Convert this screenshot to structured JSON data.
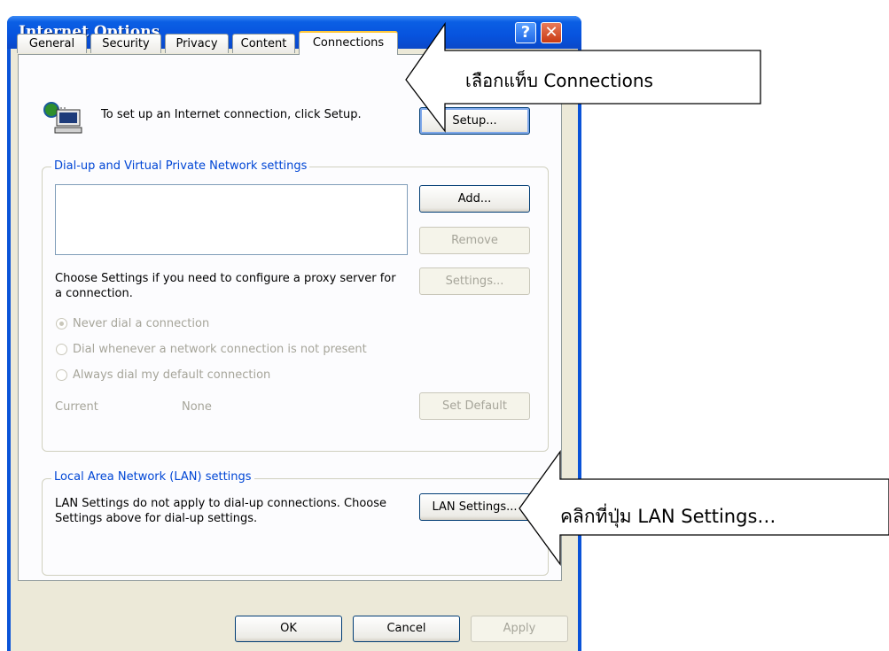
{
  "window": {
    "title": "Internet Options",
    "help_glyph": "?",
    "close_glyph": "✕"
  },
  "tabs": [
    {
      "label": "General"
    },
    {
      "label": "Security"
    },
    {
      "label": "Privacy"
    },
    {
      "label": "Content"
    },
    {
      "label": "Connections"
    }
  ],
  "setup": {
    "text": "To set up an Internet connection, click Setup.",
    "button": "Setup..."
  },
  "dialup": {
    "legend": "Dial-up and Virtual Private Network settings",
    "add": "Add...",
    "remove": "Remove",
    "settings_text": "Choose Settings if you need to configure a proxy server for a connection.",
    "settings": "Settings...",
    "radios": [
      "Never dial a connection",
      "Dial whenever a network connection is not present",
      "Always dial my default connection"
    ],
    "current_label": "Current",
    "current_value": "None",
    "set_default": "Set Default"
  },
  "lan": {
    "legend": "Local Area Network (LAN) settings",
    "text": "LAN Settings do not apply to dial-up connections. Choose Settings above for dial-up settings.",
    "button": "LAN Settings..."
  },
  "footer": {
    "ok": "OK",
    "cancel": "Cancel",
    "apply": "Apply"
  },
  "callouts": {
    "tab_hint": "เลือกแท็บ Connections",
    "lan_hint": "คลิกที่ปุ่ม LAN Settings…"
  }
}
